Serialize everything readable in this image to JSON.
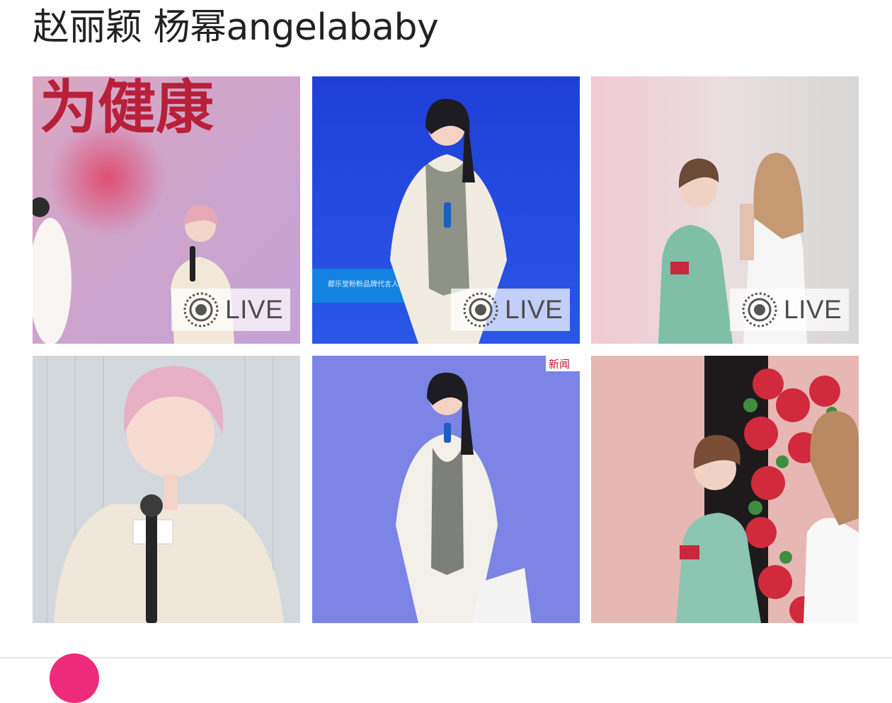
{
  "post": {
    "text": "赵丽颖 杨幂angelababy"
  },
  "photos": [
    {
      "label": "赵丽颖 舞台照",
      "live": true
    },
    {
      "label": "杨幂 蓝色背景发布会",
      "live": true
    },
    {
      "label": "angelababy 绿色礼服",
      "live": true
    },
    {
      "label": "赵丽颖 特写",
      "live": false
    },
    {
      "label": "杨幂 白色礼服",
      "live": false
    },
    {
      "label": "angelababy 花墙前",
      "live": false
    }
  ],
  "backdrop_text": "为健康",
  "corner_tag": "新闻",
  "screen_caption": "都乐堂粉粉品牌代言人",
  "live_badge": {
    "label": "LIVE",
    "icon": "live-photo-icon"
  },
  "colors": {
    "text": "#222222",
    "live_text": "#4d4d4d",
    "avatar": "#ee2b7a"
  }
}
